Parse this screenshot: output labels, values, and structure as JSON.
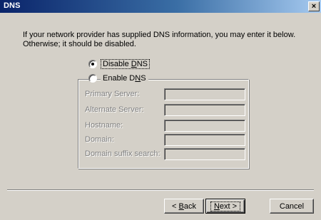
{
  "window": {
    "title": "DNS",
    "close_glyph": "×"
  },
  "intro": {
    "line1": "If your network provider has supplied DNS information, you may enter it below.",
    "line2": "Otherwise; it should be disabled."
  },
  "options": {
    "disable": {
      "label_pre": "Disable ",
      "label_key": "D",
      "label_post": "NS",
      "checked": true
    },
    "enable": {
      "label_pre": "Enable D",
      "label_key": "N",
      "label_post": "S",
      "checked": false
    }
  },
  "fields": [
    {
      "label": "Primary Server:",
      "value": ""
    },
    {
      "label": "Alternate Server:",
      "value": ""
    },
    {
      "label": "Hostname:",
      "value": ""
    },
    {
      "label": "Domain:",
      "value": ""
    },
    {
      "label": "Domain suffix search:",
      "value": ""
    }
  ],
  "buttons": {
    "back": {
      "pre": "< ",
      "key": "B",
      "post": "ack"
    },
    "next": {
      "pre": "",
      "key": "N",
      "post": "ext >"
    },
    "cancel": {
      "label": "Cancel"
    }
  },
  "colors": {
    "titlebar_start": "#0a246a",
    "titlebar_end": "#a6caf0",
    "dialog_face": "#d4d0c8",
    "disabled_text": "#808080"
  }
}
